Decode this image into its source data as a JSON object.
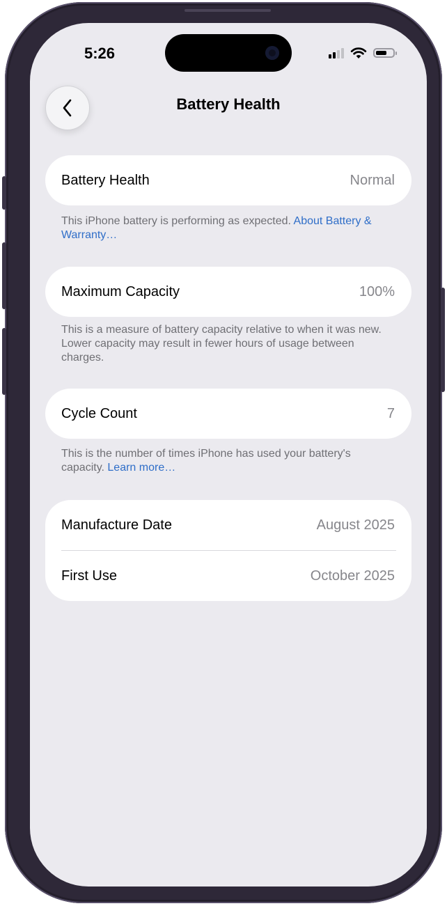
{
  "status_bar": {
    "time": "5:26",
    "icons": [
      "cellular-signal-icon",
      "wifi-icon",
      "battery-icon"
    ]
  },
  "nav": {
    "back_icon": "chevron-left-icon",
    "title": "Battery Health"
  },
  "sections": {
    "health": {
      "label": "Battery Health",
      "value": "Normal",
      "note_text": "This iPhone battery is performing as expected. ",
      "note_link": "About Battery & Warranty…"
    },
    "capacity": {
      "label": "Maximum Capacity",
      "value": "100%",
      "note_text": "This is a measure of battery capacity relative to when it was new. Lower capacity may result in fewer hours of usage between charges."
    },
    "cycles": {
      "label": "Cycle Count",
      "value": "7",
      "note_text": "This is the number of times iPhone has used your battery's capacity. ",
      "note_link": "Learn more…"
    },
    "dates": {
      "manufacture_label": "Manufacture Date",
      "manufacture_value": "August 2025",
      "first_use_label": "First Use",
      "first_use_value": "October 2025"
    }
  },
  "colors": {
    "background": "#ebeaef",
    "link": "#2f6ec8",
    "secondary_text": "#86868b"
  }
}
